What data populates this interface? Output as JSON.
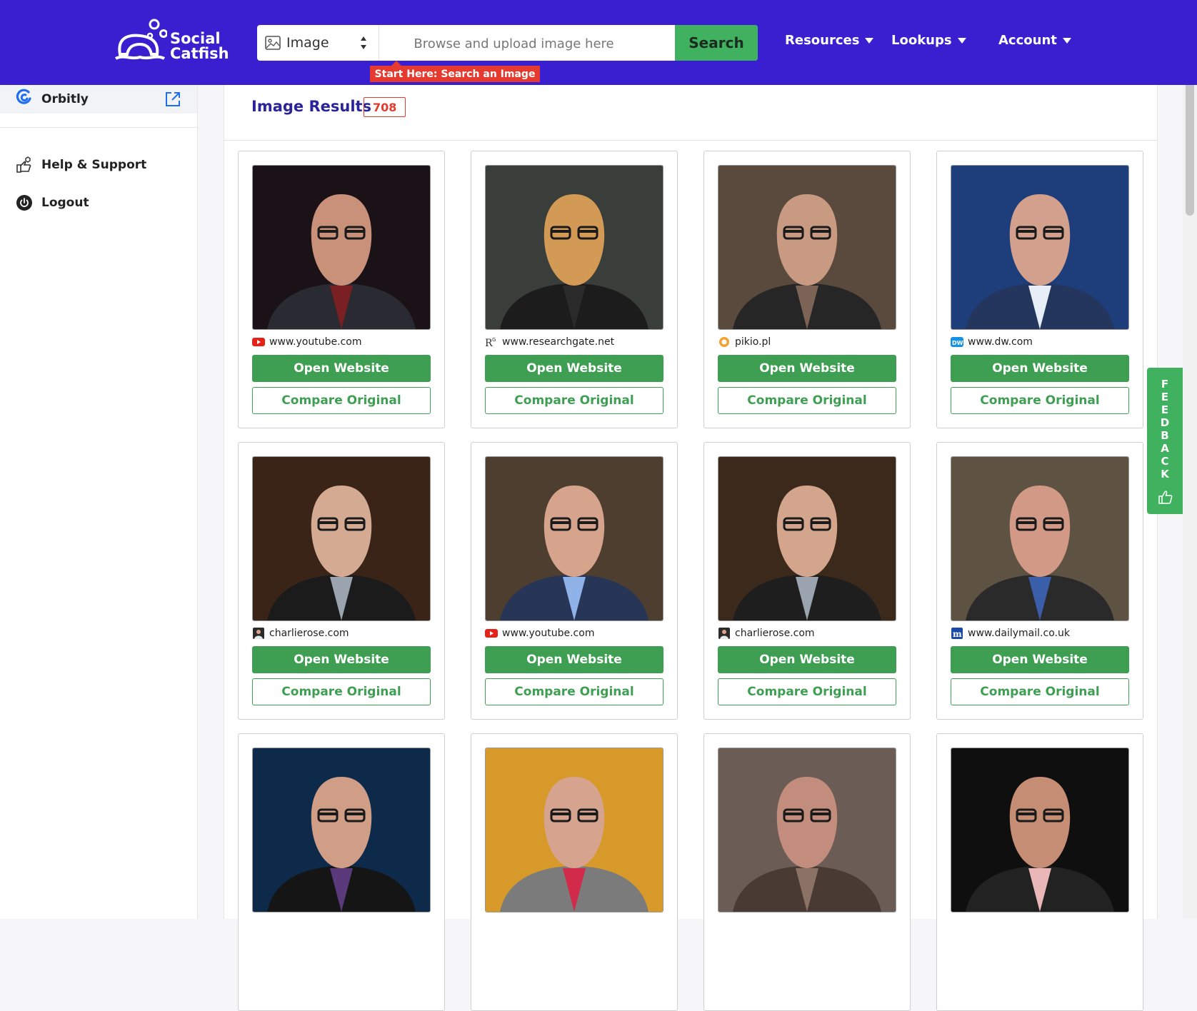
{
  "header": {
    "logo_line1": "Social",
    "logo_line2": "Catfish",
    "search_type": "Image",
    "search_placeholder": "Browse and upload image here",
    "search_button": "Search",
    "tooltip": "Start Here: Search an Image",
    "nav": [
      "Resources",
      "Lookups",
      "Account"
    ]
  },
  "sidebar": {
    "orbitly": "Orbitly",
    "help": "Help & Support",
    "logout": "Logout"
  },
  "results": {
    "title": "Image Results",
    "count": "708",
    "open_label": "Open Website",
    "compare_label": "Compare Original",
    "cards": [
      {
        "site": "www.youtube.com",
        "favicon": "youtube-icon"
      },
      {
        "site": "www.researchgate.net",
        "favicon": "researchgate-icon"
      },
      {
        "site": "pikio.pl",
        "favicon": "pikio-icon"
      },
      {
        "site": "www.dw.com",
        "favicon": "dw-icon"
      },
      {
        "site": "charlierose.com",
        "favicon": "charlierose-icon"
      },
      {
        "site": "www.youtube.com",
        "favicon": "youtube-icon"
      },
      {
        "site": "charlierose.com",
        "favicon": "charlierose-icon"
      },
      {
        "site": "www.dailymail.co.uk",
        "favicon": "dailymail-icon"
      }
    ]
  },
  "feedback": {
    "label": "FEEDBACK"
  },
  "colors": {
    "header": "#3a1fd1",
    "green": "#3e9f53",
    "accent_red": "#e23b2f",
    "title": "#2b2398"
  }
}
